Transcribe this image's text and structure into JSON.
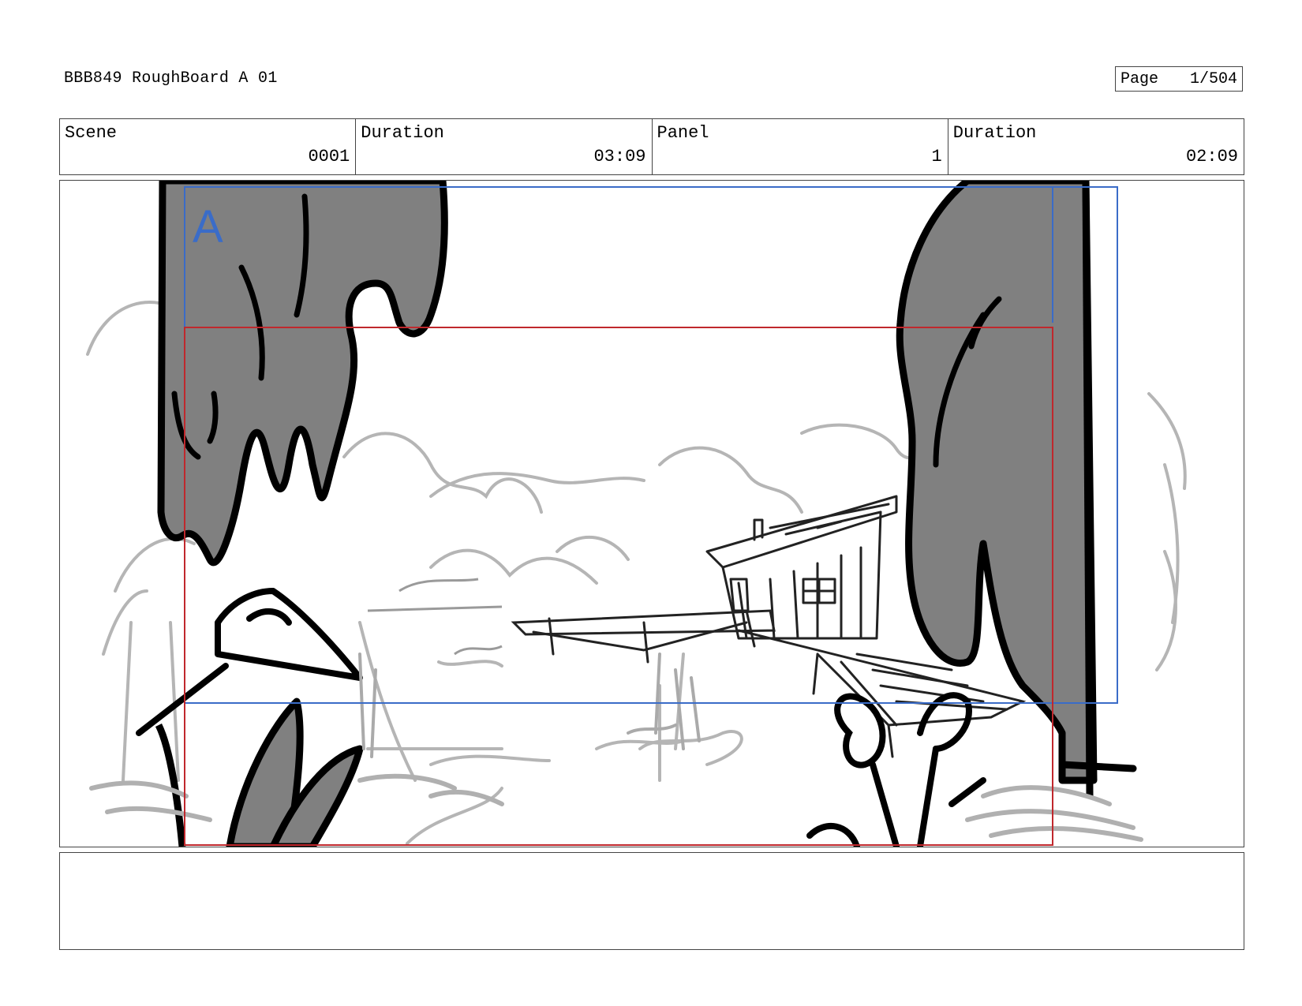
{
  "document": {
    "title": "BBB849 RoughBoard A 01",
    "page_label": "Page",
    "page_value": "1/504"
  },
  "info_table": [
    {
      "label": "Scene",
      "value": "0001"
    },
    {
      "label": "Duration",
      "value": "03:09"
    },
    {
      "label": "Panel",
      "value": "1"
    },
    {
      "label": "Duration",
      "value": "02:09"
    }
  ],
  "panel": {
    "camera_label": "A",
    "colors": {
      "camera_field": "#3a6cc8",
      "safe_frame": "#c0282d",
      "tree_fill": "#808080",
      "line_dark": "#000000",
      "line_light": "#b0b0b0"
    },
    "depicts": [
      "tree",
      "foliage",
      "dock",
      "boathouse",
      "bushes",
      "reeds",
      "net"
    ]
  },
  "notes": {
    "text": ""
  }
}
